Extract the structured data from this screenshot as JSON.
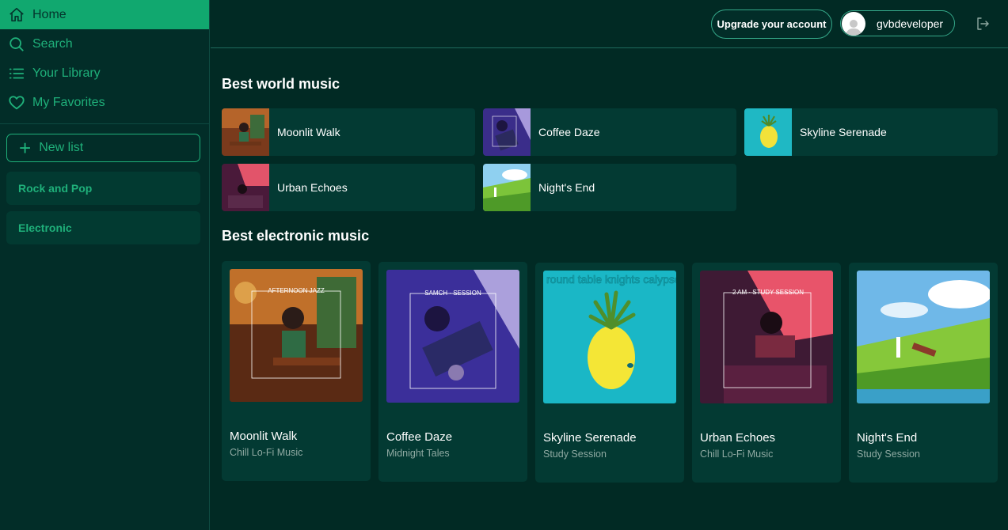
{
  "sidebar": {
    "nav": [
      {
        "label": "Home",
        "icon": "home-icon",
        "active": true
      },
      {
        "label": "Search",
        "icon": "search-icon"
      },
      {
        "label": "Your Library",
        "icon": "list-icon"
      },
      {
        "label": "My Favorites",
        "icon": "heart-icon"
      }
    ],
    "new_list_label": "New list",
    "playlists": [
      "Rock and Pop",
      "Electronic"
    ]
  },
  "topbar": {
    "upgrade_label": "Upgrade your account",
    "username": "gvbdeveloper"
  },
  "sections": {
    "world": {
      "title": "Best world music",
      "items": [
        {
          "title": "Moonlit Walk"
        },
        {
          "title": "Coffee Daze"
        },
        {
          "title": "Skyline Serenade"
        },
        {
          "title": "Urban Echoes"
        },
        {
          "title": "Night's End"
        }
      ]
    },
    "electronic": {
      "title": "Best electronic music",
      "items": [
        {
          "title": "Moonlit Walk",
          "subtitle": "Chill Lo-Fi Music",
          "art_text": "AFTERNOON JAZZ"
        },
        {
          "title": "Coffee Daze",
          "subtitle": "Midnight Tales",
          "art_text": "SAMCH · SESSION"
        },
        {
          "title": "Skyline Serenade",
          "subtitle": "Study Session",
          "art_text": "round table knights calypso ep"
        },
        {
          "title": "Urban Echoes",
          "subtitle": "Chill Lo-Fi Music",
          "art_text": "2 AM · STUDY SESSION"
        },
        {
          "title": "Night's End",
          "subtitle": "Study Session",
          "art_text": ""
        }
      ]
    }
  },
  "colors": {
    "background": "#012a24",
    "sidebar": "#022d28",
    "accent": "#1fb07a",
    "active_nav": "#11a86f",
    "card": "#033a33"
  }
}
